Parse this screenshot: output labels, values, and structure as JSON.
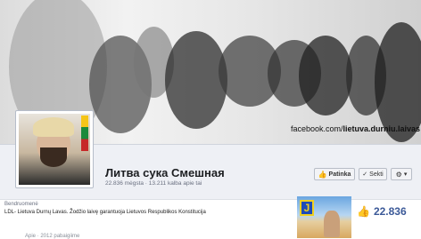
{
  "cover": {
    "url_prefix": "facebook.com/",
    "url_bold": "lietuva.durniu.laivas"
  },
  "page": {
    "title": "Литва сука Смешная",
    "stats": "22.836 mėgsta · 13.211 kalba apie tai"
  },
  "actions": {
    "like_label": "Patinka",
    "follow_label": "Sekti",
    "more_label": "▾"
  },
  "about": {
    "heading": "Bendruomenė",
    "text": "LDL- Lietuva Durnų Lavas. Žodžio laivę garantuoja Lietuvos Respublikos Konstitucija"
  },
  "thumb": {
    "letter": "J"
  },
  "likes": {
    "count": "22.836"
  },
  "tabs": {
    "text": "Apie · 2012 pabaigiime"
  },
  "colors": {
    "brand": "#3b5998",
    "header_bg": "#eef0f5"
  }
}
